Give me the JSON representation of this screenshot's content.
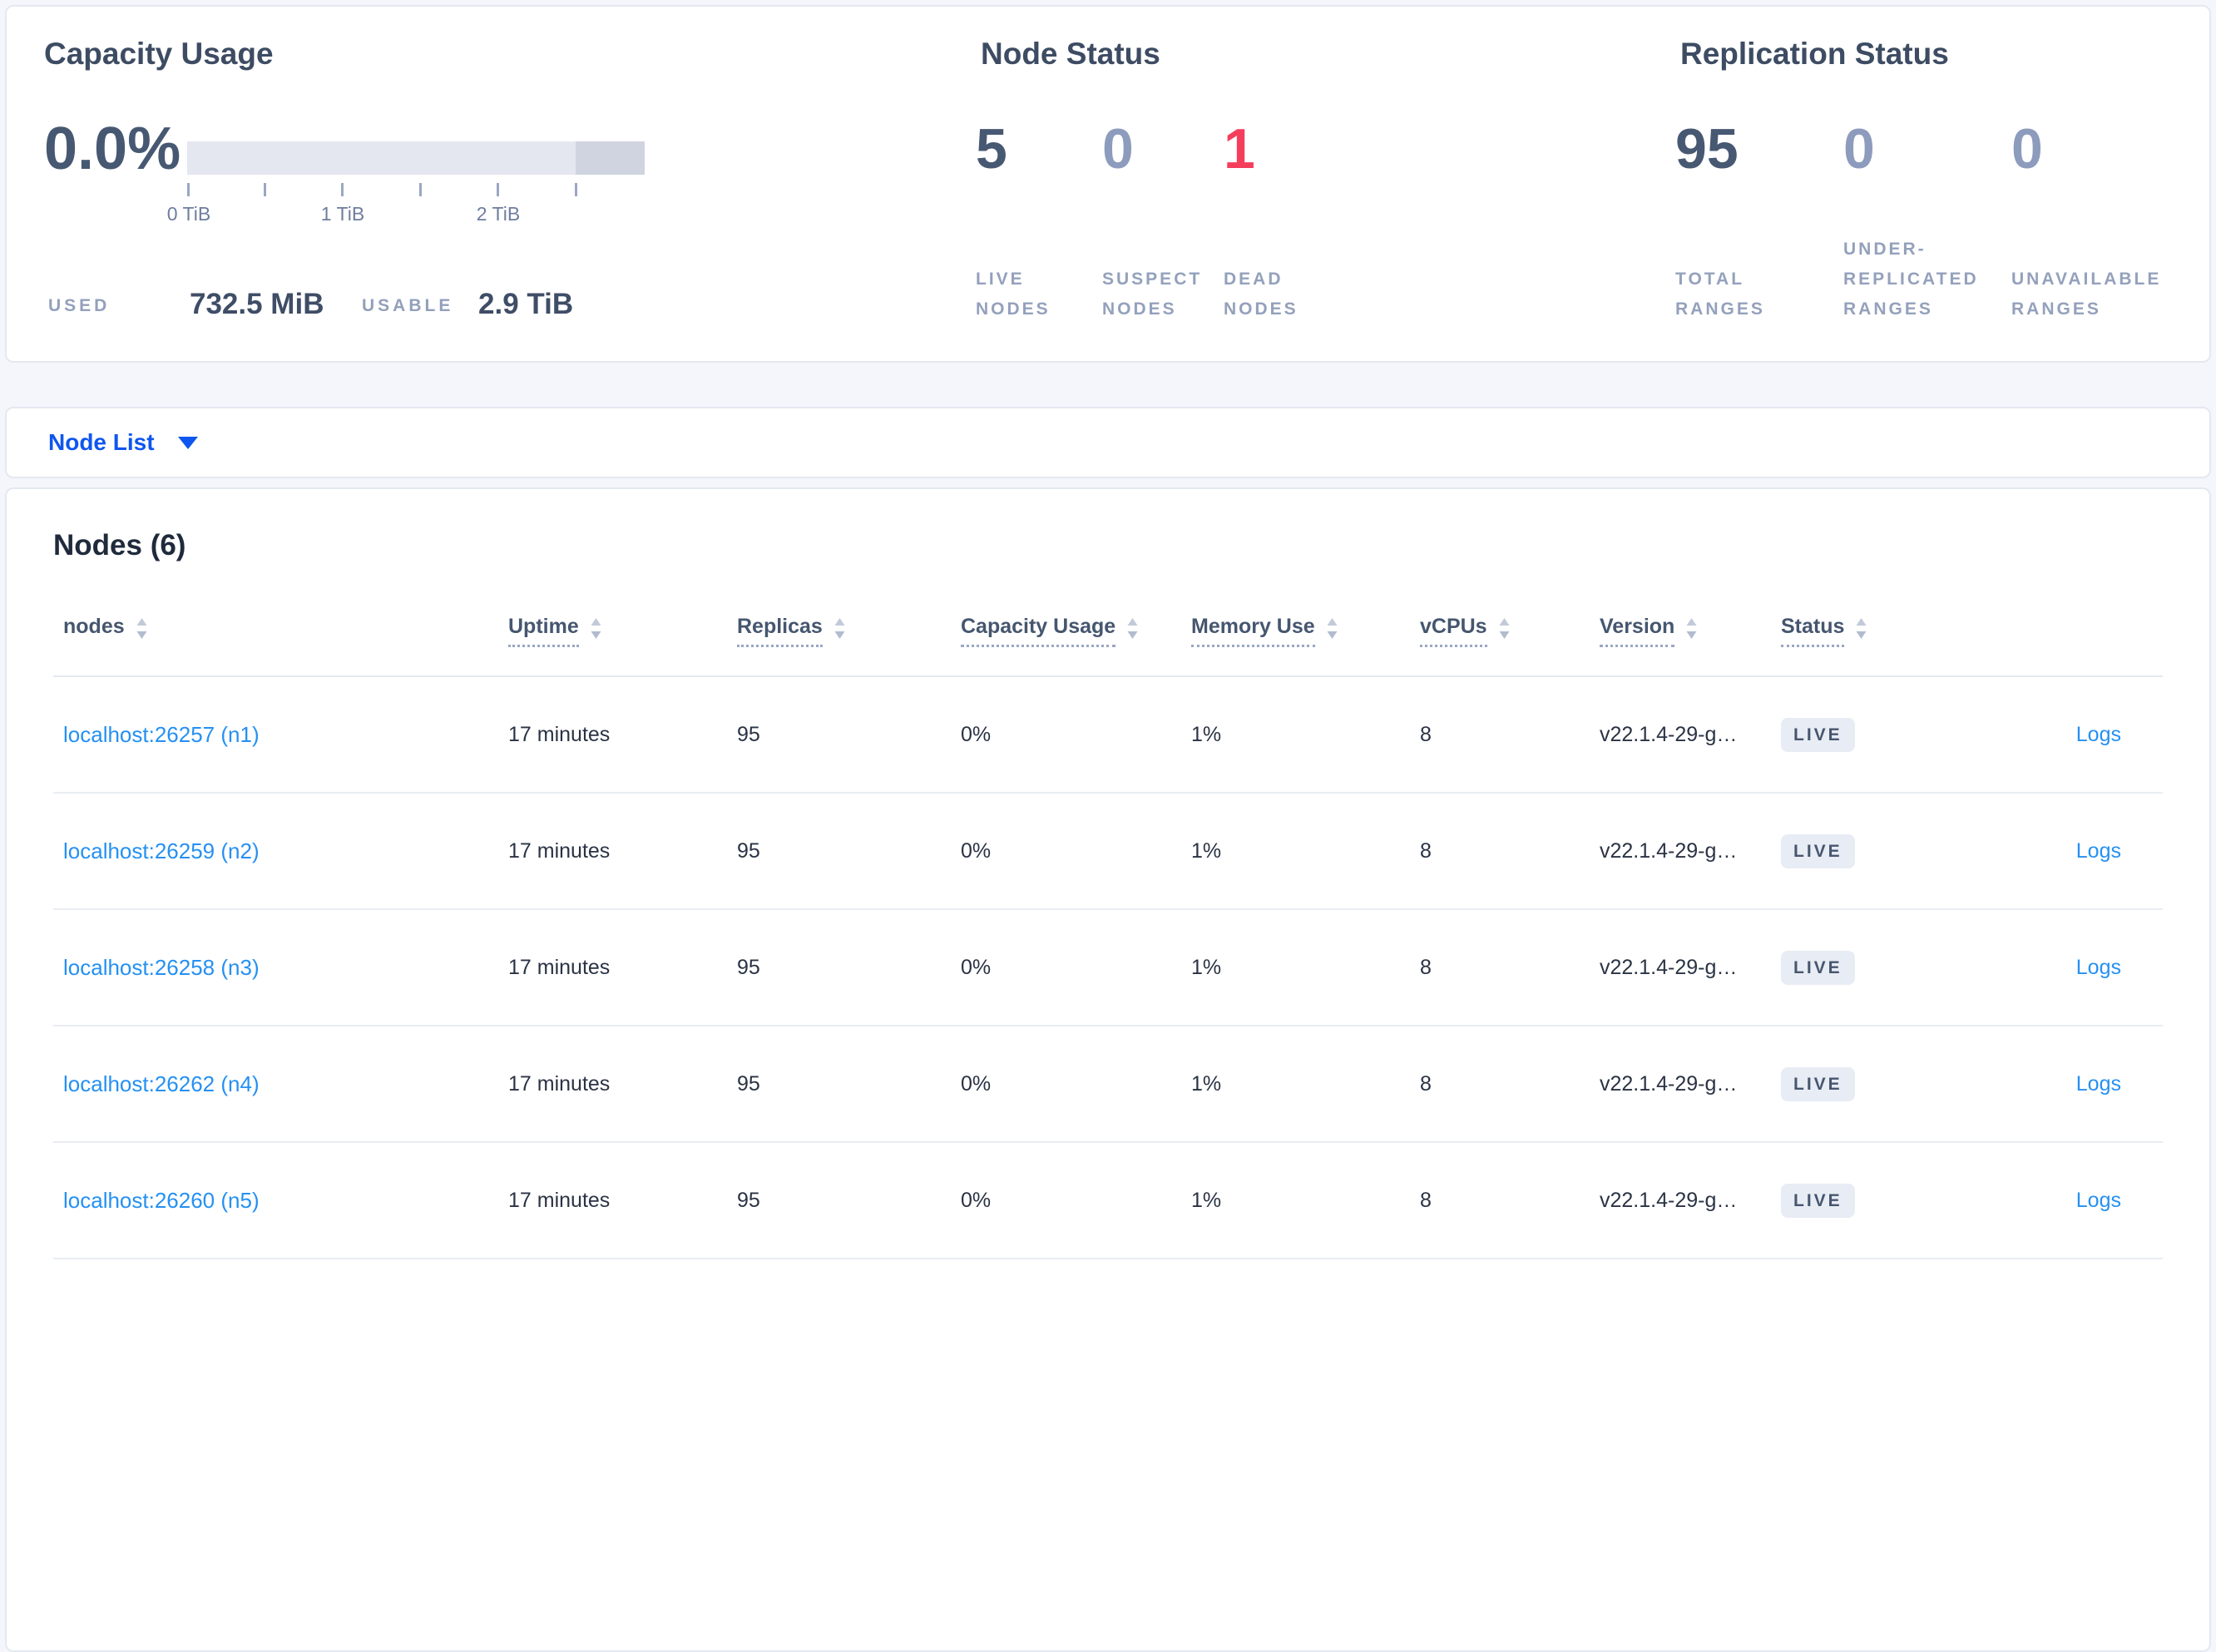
{
  "summary": {
    "capacity": {
      "title": "Capacity Usage",
      "percent": "0.0%",
      "ticks": [
        "0 TiB",
        "1 TiB",
        "2 TiB"
      ],
      "used_label": "USED",
      "used_value": "732.5 MiB",
      "usable_label": "USABLE",
      "usable_value": "2.9 TiB"
    },
    "node_status": {
      "title": "Node Status",
      "metrics": [
        {
          "value": "5",
          "label": "LIVE NODES",
          "tone": "dark"
        },
        {
          "value": "0",
          "label": "SUSPECT NODES",
          "tone": "muted"
        },
        {
          "value": "1",
          "label": "DEAD NODES",
          "tone": "danger"
        }
      ]
    },
    "replication": {
      "title": "Replication Status",
      "metrics": [
        {
          "value": "95",
          "label": "TOTAL RANGES",
          "tone": "dark"
        },
        {
          "value": "0",
          "label": "UNDER- REPLICATED RANGES",
          "tone": "muted"
        },
        {
          "value": "0",
          "label": "UNAVAILABLE RANGES",
          "tone": "muted"
        }
      ]
    }
  },
  "view_selector": {
    "label": "Node List",
    "icon": "caret-down-icon"
  },
  "nodes_table": {
    "title": "Nodes (6)",
    "columns": [
      "nodes",
      "Uptime",
      "Replicas",
      "Capacity Usage",
      "Memory Use",
      "vCPUs",
      "Version",
      "Status"
    ],
    "rows": [
      {
        "node": "localhost:26257 (n1)",
        "uptime": "17 minutes",
        "replicas": "95",
        "capacity": "0%",
        "memory": "1%",
        "vcpus": "8",
        "version": "v22.1.4-29-g…",
        "status": "LIVE",
        "logs": "Logs"
      },
      {
        "node": "localhost:26259 (n2)",
        "uptime": "17 minutes",
        "replicas": "95",
        "capacity": "0%",
        "memory": "1%",
        "vcpus": "8",
        "version": "v22.1.4-29-g…",
        "status": "LIVE",
        "logs": "Logs"
      },
      {
        "node": "localhost:26258 (n3)",
        "uptime": "17 minutes",
        "replicas": "95",
        "capacity": "0%",
        "memory": "1%",
        "vcpus": "8",
        "version": "v22.1.4-29-g…",
        "status": "LIVE",
        "logs": "Logs"
      },
      {
        "node": "localhost:26262 (n4)",
        "uptime": "17 minutes",
        "replicas": "95",
        "capacity": "0%",
        "memory": "1%",
        "vcpus": "8",
        "version": "v22.1.4-29-g…",
        "status": "LIVE",
        "logs": "Logs"
      },
      {
        "node": "localhost:26260 (n5)",
        "uptime": "17 minutes",
        "replicas": "95",
        "capacity": "0%",
        "memory": "1%",
        "vcpus": "8",
        "version": "v22.1.4-29-g…",
        "status": "LIVE",
        "logs": "Logs"
      }
    ]
  },
  "colors": {
    "page_bg": "#f4f6fb",
    "card_border": "#e4e8f1",
    "metric_dark": "#475872",
    "metric_muted": "#8d9cbd",
    "metric_danger": "#f53d5c",
    "label_muted": "#94a1bc",
    "table_link": "#2590f2",
    "selector_blue": "#0f56f0",
    "badge_bg": "#e8ecf4",
    "bar_light": "#e4e7ef",
    "bar_dark": "#cfd4e0"
  }
}
